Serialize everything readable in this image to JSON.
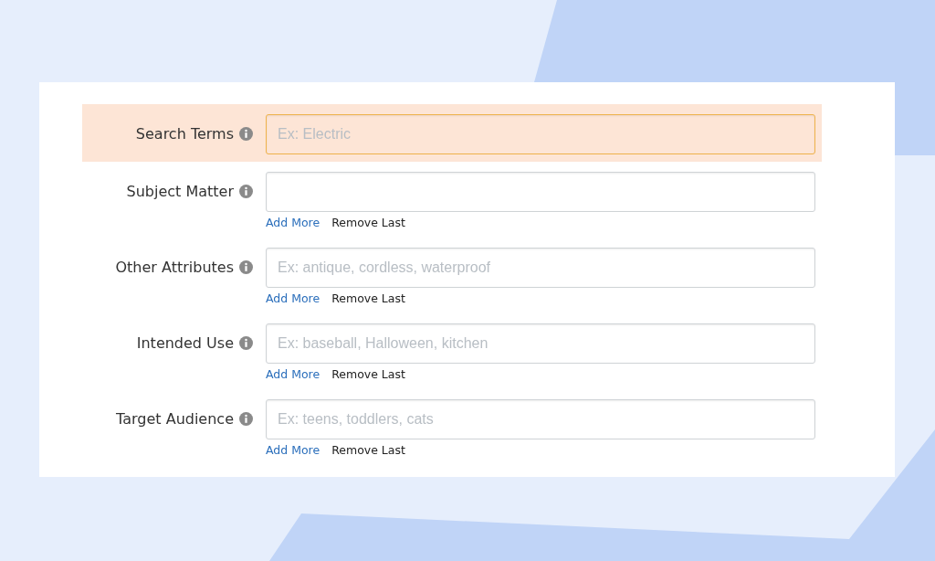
{
  "fields": [
    {
      "label": "Search Terms",
      "placeholder": "Ex: Electric",
      "focused": true
    },
    {
      "label": "Subject Matter",
      "focused": false,
      "actions": [
        {
          "label": "Add More",
          "kind": "primary"
        },
        {
          "label": "Remove Last",
          "kind": "secondary"
        }
      ]
    },
    {
      "label": "Other Attributes",
      "placeholder": "Ex: antique, cordless, waterproof",
      "focused": false,
      "actions": [
        {
          "label": "Add More",
          "kind": "primary"
        },
        {
          "label": "Remove Last",
          "kind": "secondary"
        }
      ]
    },
    {
      "label": "Intended Use",
      "placeholder": "Ex: baseball, Halloween, kitchen",
      "focused": false,
      "actions": [
        {
          "label": "Add More",
          "kind": "primary"
        },
        {
          "label": "Remove Last",
          "kind": "secondary"
        }
      ]
    },
    {
      "label": "Target Audience",
      "placeholder": "Ex: teens, toddlers, cats",
      "focused": false,
      "actions": [
        {
          "label": "Add More",
          "kind": "primary"
        },
        {
          "label": "Remove Last",
          "kind": "secondary"
        }
      ]
    }
  ]
}
